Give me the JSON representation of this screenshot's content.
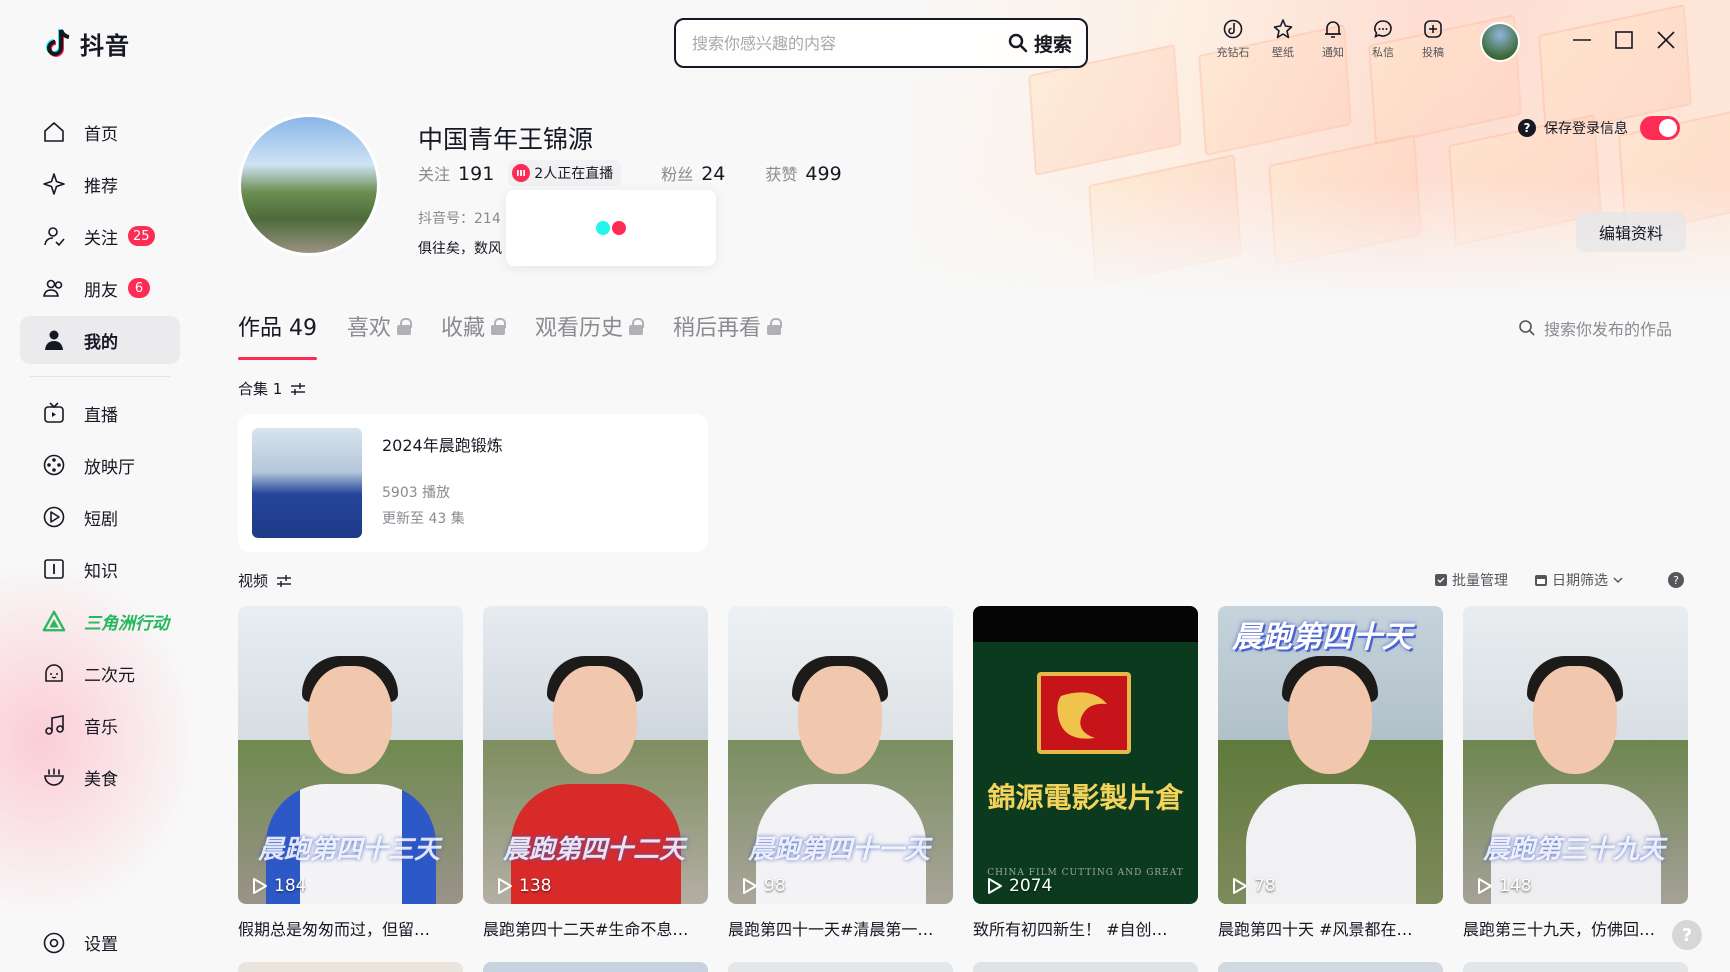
{
  "app": {
    "name": "抖音"
  },
  "search": {
    "placeholder": "搜索你感兴趣的内容",
    "button": "搜索"
  },
  "top_actions": [
    {
      "label": "充钻石",
      "icon": "diamond-icon"
    },
    {
      "label": "壁纸",
      "icon": "wallpaper-icon"
    },
    {
      "label": "通知",
      "icon": "bell-icon"
    },
    {
      "label": "私信",
      "icon": "message-icon"
    },
    {
      "label": "投稿",
      "icon": "upload-icon"
    }
  ],
  "sidebar": {
    "items": [
      {
        "label": "首页",
        "icon": "home-icon"
      },
      {
        "label": "推荐",
        "icon": "sparkle-icon"
      },
      {
        "label": "关注",
        "icon": "follow-icon",
        "badge": "25"
      },
      {
        "label": "朋友",
        "icon": "friends-icon",
        "badge": "6"
      },
      {
        "label": "我的",
        "icon": "user-icon",
        "active": true
      }
    ],
    "items2": [
      {
        "label": "直播",
        "icon": "tv-icon"
      },
      {
        "label": "放映厅",
        "icon": "film-reel-icon"
      },
      {
        "label": "短剧",
        "icon": "play-stack-icon"
      },
      {
        "label": "知识",
        "icon": "book-icon"
      },
      {
        "label": "三角洲行动",
        "icon": "delta-icon",
        "special": true
      },
      {
        "label": "二次元",
        "icon": "anime-icon"
      },
      {
        "label": "音乐",
        "icon": "music-icon"
      },
      {
        "label": "美食",
        "icon": "food-icon"
      }
    ],
    "settings": "设置"
  },
  "profile": {
    "name": "中国青年王锦源",
    "following_label": "关注",
    "following": "191",
    "live_text": "2人正在直播",
    "fans_label": "粉丝",
    "fans": "24",
    "likes_label": "获赞",
    "likes": "499",
    "douyin_id": "抖音号：214",
    "bio": "俱往矣，数风",
    "save_login": "保存登录信息",
    "edit": "编辑资料"
  },
  "tabs": [
    {
      "label": "作品 49",
      "active": true,
      "locked": false
    },
    {
      "label": "喜欢",
      "locked": true
    },
    {
      "label": "收藏",
      "locked": true
    },
    {
      "label": "观看历史",
      "locked": true
    },
    {
      "label": "稍后再看",
      "locked": true
    }
  ],
  "tab_search": "搜索你发布的作品",
  "collections": {
    "label": "合集 1",
    "items": [
      {
        "title": "2024年晨跑锻炼",
        "plays": "5903 播放",
        "updated": "更新至 43 集"
      }
    ]
  },
  "videos": {
    "label": "视频",
    "batch": "批量管理",
    "date_filter": "日期筛选",
    "items": [
      {
        "plays": "184",
        "overlay": "晨跑第四十三天",
        "caption": "假期总是匆匆而过，但留…"
      },
      {
        "plays": "138",
        "overlay": "晨跑第四十二天",
        "caption": "晨跑第四十二天#生命不息…"
      },
      {
        "plays": "98",
        "overlay": "晨跑第四十一天",
        "caption": "晨跑第四十一天#清晨第一…"
      },
      {
        "plays": "2074",
        "overlay": "錦源電影製片倉",
        "sub": "CHINA FILM CUTTING AND GREAT",
        "caption": "致所有初四新生！ #自创…"
      },
      {
        "plays": "78",
        "overlay": "晨跑第四十天",
        "caption": "晨跑第四十天 #风景都在…"
      },
      {
        "plays": "148",
        "overlay": "晨跑第三十九天",
        "caption": "晨跑第三十九天，仿佛回…"
      }
    ]
  },
  "colors": {
    "accent": "#fe2c55",
    "cyan": "#25f4ee",
    "text": "#161823",
    "muted": "#8a8b91"
  }
}
